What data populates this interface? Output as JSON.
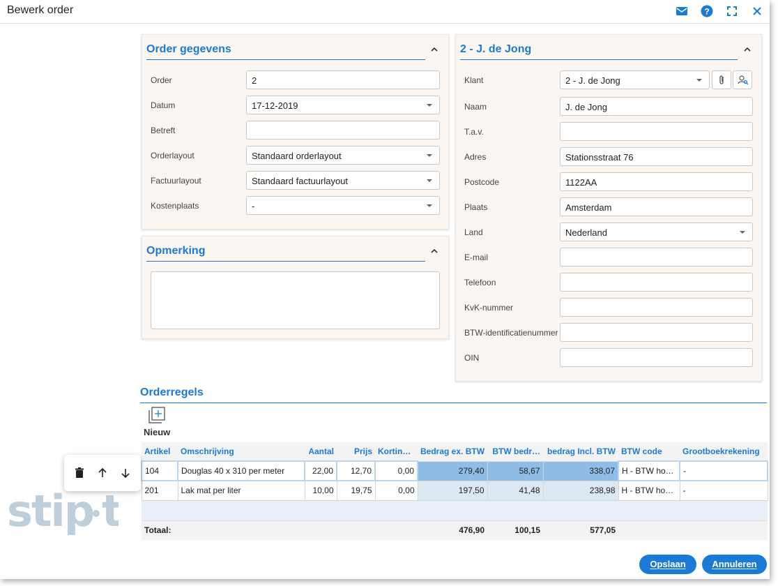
{
  "window": {
    "title": "Bewerk order"
  },
  "titlebar_icons": [
    "mail-icon",
    "help-icon",
    "fullscreen-icon",
    "close-icon"
  ],
  "order_panel": {
    "title": "Order gegevens",
    "fields": [
      {
        "label": "Order",
        "value": "2",
        "type": "text"
      },
      {
        "label": "Datum",
        "value": "17-12-2019",
        "type": "select"
      },
      {
        "label": "Betreft",
        "value": "",
        "type": "text"
      },
      {
        "label": "Orderlayout",
        "value": "Standaard orderlayout",
        "type": "select"
      },
      {
        "label": "Factuurlayout",
        "value": "Standaard factuurlayout",
        "type": "select"
      },
      {
        "label": "Kostenplaats",
        "value": "-",
        "type": "select"
      }
    ]
  },
  "remark_panel": {
    "title": "Opmerking",
    "value": ""
  },
  "customer_panel": {
    "title": "2 - J. de Jong",
    "fields": [
      {
        "label": "Klant",
        "value": "2 - J. de Jong",
        "type": "select"
      },
      {
        "label": "Naam",
        "value": "J. de Jong",
        "type": "text"
      },
      {
        "label": "T.a.v.",
        "value": "",
        "type": "text"
      },
      {
        "label": "Adres",
        "value": "Stationsstraat 76",
        "type": "text"
      },
      {
        "label": "Postcode",
        "value": "1122AA",
        "type": "text"
      },
      {
        "label": "Plaats",
        "value": "Amsterdam",
        "type": "text"
      },
      {
        "label": "Land",
        "value": "Nederland",
        "type": "select"
      },
      {
        "label": "E-mail",
        "value": "",
        "type": "text"
      },
      {
        "label": "Telefoon",
        "value": "",
        "type": "text"
      },
      {
        "label": "KvK-nummer",
        "value": "",
        "type": "text"
      },
      {
        "label": "BTW-identificatienummer",
        "value": "",
        "type": "text"
      },
      {
        "label": "OIN",
        "value": "",
        "type": "text"
      }
    ]
  },
  "orderlines": {
    "title": "Orderregels",
    "new_label": "Nieuw",
    "columns": [
      "Artikel",
      "Omschrijving",
      "Aantal",
      "Prijs",
      "Korting%",
      "Bedrag ex. BTW",
      "BTW bedr…",
      "bedrag Incl. BTW",
      "BTW code",
      "Grootboekrekening"
    ],
    "rows": [
      [
        "104",
        "Douglas 40 x 310 per meter",
        "22,00",
        "12,70",
        "0,00",
        "279,40",
        "58,67",
        "338,07",
        "H - BTW ho…",
        "-"
      ],
      [
        "201",
        "Lak mat per liter",
        "10,00",
        "19,75",
        "0,00",
        "197,50",
        "41,48",
        "238,98",
        "H - BTW ho…",
        "-"
      ]
    ],
    "total": {
      "label": "Totaal:",
      "ex_btw": "476,90",
      "btw": "100,15",
      "incl_btw": "577,05"
    }
  },
  "row_actions": [
    "trash-icon",
    "arrow-up-icon",
    "arrow-down-icon"
  ],
  "logo_text": "stipt",
  "buttons": {
    "save": "Opslaan",
    "cancel": "Annuleren"
  },
  "colors": {
    "accent": "#1a7bd6",
    "panel_bg": "#fbf6f1",
    "selected_calc": "#8fbde8"
  }
}
